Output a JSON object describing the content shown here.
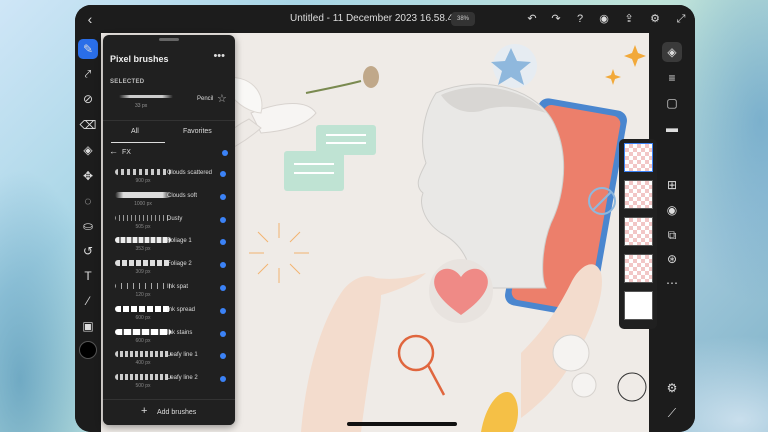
{
  "document": {
    "title": "Untitled - 11 December 2023 16.58.45 *",
    "zoom": "38%"
  },
  "brush_panel": {
    "title": "Pixel brushes",
    "selected_header": "SELECTED",
    "selected_brush": {
      "name": "Pencil",
      "size": "33 px"
    },
    "tabs": [
      "All",
      "Favorites"
    ],
    "active_tab": "All",
    "category": "FX",
    "brushes": [
      {
        "name": "Clouds scattered",
        "size": "900 px"
      },
      {
        "name": "Clouds soft",
        "size": "1000 px"
      },
      {
        "name": "Dusty",
        "size": "505 px"
      },
      {
        "name": "Foliage 1",
        "size": "353 px"
      },
      {
        "name": "Foliage 2",
        "size": "309 px"
      },
      {
        "name": "Ink spat",
        "size": "120 px"
      },
      {
        "name": "Ink spread",
        "size": "600 px"
      },
      {
        "name": "Ink stains",
        "size": "600 px"
      },
      {
        "name": "Leafy line 1",
        "size": "400 px"
      },
      {
        "name": "Leafy line 2",
        "size": "500 px"
      }
    ],
    "add_label": "Add brushes"
  },
  "left_tools": [
    "brush-icon",
    "smudge-icon",
    "fill-icon",
    "eraser-icon",
    "clone-icon",
    "move-icon",
    "lasso-icon",
    "paint-bucket-icon",
    "undo-brush-icon",
    "text-icon",
    "eyedropper-icon",
    "image-icon"
  ],
  "right_tools": [
    "layers-icon",
    "adjustments-icon",
    "properties-icon",
    "comments-icon",
    "add-layer-icon",
    "visibility-icon",
    "mask-icon",
    "blend-icon",
    "more-icon",
    "settings-icon",
    "ruler-icon"
  ],
  "accent_color": "#3b82f6"
}
